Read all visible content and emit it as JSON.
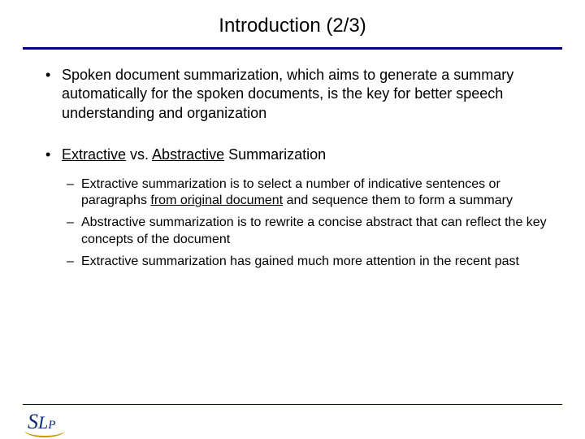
{
  "title": "Introduction (2/3)",
  "bullets": {
    "item0": {
      "text": "Spoken document summarization, which aims to generate a summary automatically for the spoken documents, is the key for better speech understanding and organization"
    },
    "item1": {
      "seg1": "Extractive",
      "seg2": " vs. ",
      "seg3": "Abstractive",
      "seg4": " Summarization",
      "sub": {
        "s0a": "Extractive summarization is to select a number of indicative sentences or paragraphs ",
        "s0b": "from original document",
        "s0c": "  and sequence them to form a summary",
        "s1": "Abstractive summarization is to rewrite a concise abstract that can reflect the key concepts of the document",
        "s2": "Extractive summarization has gained much more attention in the recent past"
      }
    }
  },
  "logo": {
    "s": "S",
    "l": "L",
    "p": "P"
  }
}
